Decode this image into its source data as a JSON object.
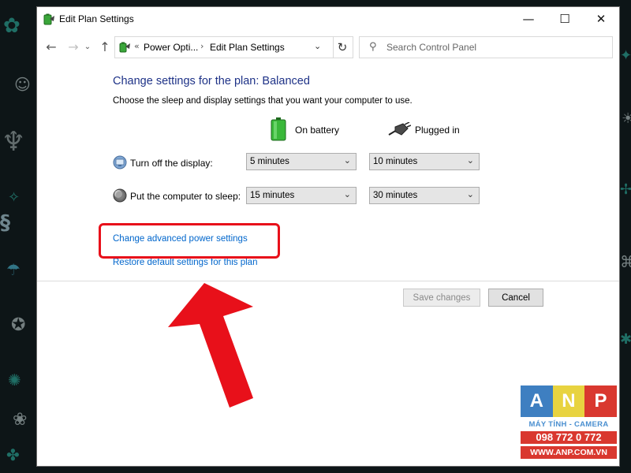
{
  "window": {
    "title": "Edit Plan Settings",
    "minimize_glyph": "—",
    "maximize_glyph": "☐",
    "close_glyph": "✕"
  },
  "address": {
    "breadcrumb": [
      "Power Opti...",
      "Edit Plan Settings"
    ],
    "breadcrumb_separator": "›",
    "search_placeholder": "Search Control Panel"
  },
  "main": {
    "heading": "Change settings for the plan: Balanced",
    "subtext": "Choose the sleep and display settings that you want your computer to use.",
    "columns": {
      "battery_label": "On battery",
      "plugged_label": "Plugged in"
    },
    "rows": [
      {
        "label": "Turn off the display:",
        "on_battery": "5 minutes",
        "plugged_in": "10 minutes",
        "icon": "monitor-icon"
      },
      {
        "label": "Put the computer to sleep:",
        "on_battery": "15 minutes",
        "plugged_in": "30 minutes",
        "icon": "moon-icon"
      }
    ],
    "links": {
      "advanced": "Change advanced power settings",
      "restore": "Restore default settings for this plan"
    },
    "buttons": {
      "save": "Save changes",
      "cancel": "Cancel"
    }
  },
  "annotation": {
    "highlight_color": "#e8101a",
    "arrow_color": "#e8101a"
  },
  "watermark": {
    "letters": [
      "A",
      "N",
      "P"
    ],
    "subtitle": "MÁY TÍNH - CAMERA",
    "phone": "098 772 0 772",
    "website": "WWW.ANP.COM.VN"
  },
  "colors": {
    "heading": "#1e3287",
    "link": "#0066cc",
    "wallpaper": "#0d1517"
  }
}
